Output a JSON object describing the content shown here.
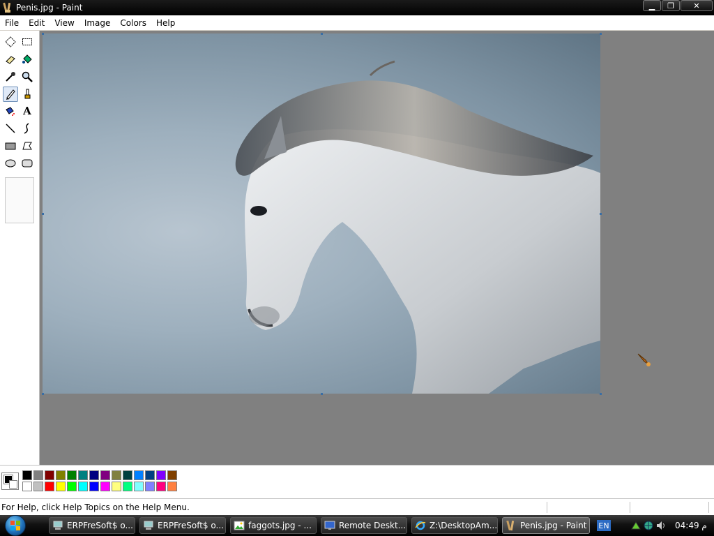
{
  "window": {
    "title": "Penis.jpg - Paint",
    "minimize_glyph": "▁",
    "restore_glyph": "❐",
    "close_glyph": "✕"
  },
  "menu": {
    "items": [
      "File",
      "Edit",
      "View",
      "Image",
      "Colors",
      "Help"
    ]
  },
  "toolbox": {
    "tools": [
      {
        "name": "free-select-icon"
      },
      {
        "name": "rect-select-icon"
      },
      {
        "name": "eraser-icon"
      },
      {
        "name": "fill-bucket-icon"
      },
      {
        "name": "color-picker-icon"
      },
      {
        "name": "magnifier-icon"
      },
      {
        "name": "pencil-icon",
        "active": true
      },
      {
        "name": "brush-icon"
      },
      {
        "name": "airbrush-icon"
      },
      {
        "name": "text-icon",
        "glyph": "A"
      },
      {
        "name": "line-icon"
      },
      {
        "name": "curve-icon"
      },
      {
        "name": "rectangle-icon"
      },
      {
        "name": "polygon-icon"
      },
      {
        "name": "ellipse-icon"
      },
      {
        "name": "rounded-rect-icon"
      }
    ]
  },
  "palette": {
    "foreground": "#000000",
    "background": "#ffffff",
    "colors": [
      "#000000",
      "#808080",
      "#800000",
      "#808000",
      "#008000",
      "#008080",
      "#000080",
      "#800080",
      "#808040",
      "#004040",
      "#0080ff",
      "#004080",
      "#8000ff",
      "#804000",
      "#ffffff",
      "#c0c0c0",
      "#ff0000",
      "#ffff00",
      "#00ff00",
      "#00ffff",
      "#0000ff",
      "#ff00ff",
      "#ffff80",
      "#00ff80",
      "#80ffff",
      "#8080ff",
      "#ff0080",
      "#ff8040"
    ]
  },
  "status": {
    "help_text": "For Help, click Help Topics on the Help Menu."
  },
  "taskbar": {
    "tasks": [
      {
        "label": "ERPFreSoft$ o...",
        "icon": "network-icon"
      },
      {
        "label": "ERPFreSoft$ o...",
        "icon": "network-icon"
      },
      {
        "label": "faggots.jpg - ...",
        "icon": "image-icon"
      },
      {
        "label": "Remote Deskt...",
        "icon": "remote-desktop-icon"
      },
      {
        "label": "Z:\\DesktopAm...",
        "icon": "ie-icon"
      },
      {
        "label": "Penis.jpg - Paint",
        "icon": "paint-icon",
        "active": true
      }
    ],
    "language": "EN",
    "clock": "04:49 م"
  }
}
